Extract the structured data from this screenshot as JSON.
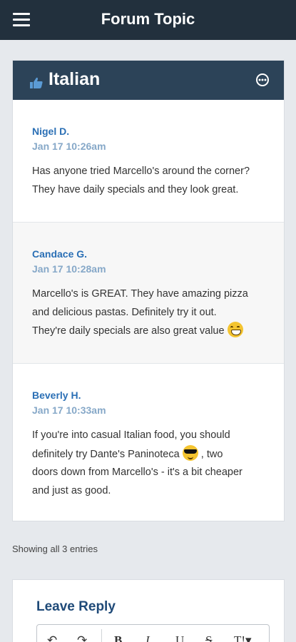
{
  "app": {
    "title": "Forum Topic"
  },
  "topic": {
    "title": "Italian",
    "icon": "thumbs-up-icon",
    "options_icon": "options-icon"
  },
  "posts": [
    {
      "author": "Nigel D.",
      "time": "Jan 17 10:26am",
      "lines": [
        "Has anyone tried Marcello's around the corner?",
        "They have daily specials and they look great."
      ]
    },
    {
      "author": "Candace G.",
      "time": "Jan 17 10:28am",
      "lines": [
        "Marcello's is GREAT. They have amazing pizza",
        "and delicious pastas. Definitely try it out.",
        "They're daily specials are also great value"
      ],
      "emoji": "grinning-face"
    },
    {
      "author": "Beverly H.",
      "time": "Jan 17 10:33am",
      "lines": [
        "If you're into casual Italian food, you should",
        "definitely try Dante's Paninoteca",
        ", two",
        "doors down from Marcello's - it's a bit cheaper",
        "and just as good."
      ],
      "emoji": "sunglasses-face"
    }
  ],
  "entries_text": "Showing all 3 entries",
  "reply": {
    "title": "Leave Reply",
    "toolbar": {
      "undo": "↶",
      "redo": "↷",
      "bold": "B",
      "italic": "I",
      "underline": "U",
      "strike": "S",
      "textsize": "T!▾"
    }
  },
  "colors": {
    "topbar": "#22303d",
    "topic_header": "#2c4358",
    "author": "#2a6fb5",
    "time": "#86a8c8",
    "background": "#e6e9ed"
  }
}
